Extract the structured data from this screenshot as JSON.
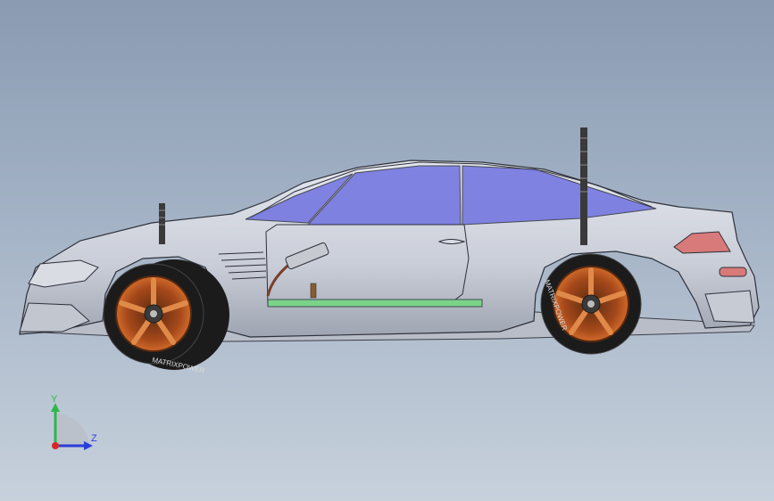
{
  "triad": {
    "y_label": "Y",
    "z_label": "Z",
    "y_color": "#2db84a",
    "z_color": "#2a3fd8",
    "origin_color": "#d8262a"
  },
  "model": {
    "body_color": "#cfd3dd",
    "glass_color": "#6f72e0",
    "rim_color": "#b3541e",
    "tire_color": "#1b1b1b",
    "taillight_color": "#d97a7a",
    "board_color": "#7bd38a",
    "tire_text": "MATRIXPOWER"
  }
}
